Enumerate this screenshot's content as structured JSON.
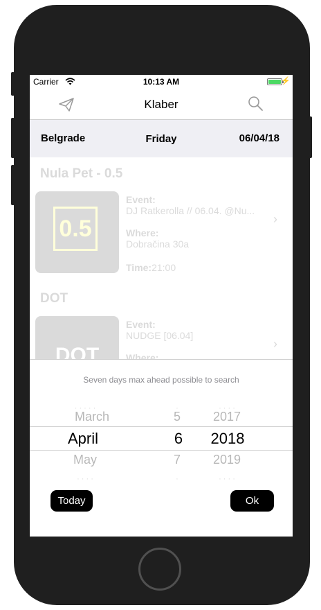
{
  "status_bar": {
    "carrier": "Carrier",
    "time": "10:13 AM",
    "battery_level": 1.0
  },
  "nav": {
    "title": "Klaber",
    "left_icon": "paper-plane-icon",
    "right_icon": "search-icon"
  },
  "info_bar": {
    "city": "Belgrade",
    "day": "Friday",
    "date": "06/04/18"
  },
  "events": [
    {
      "venue": "Nula Pet - 0.5",
      "thumb_text": "0.5",
      "event_label": "Event:",
      "event_value": "DJ Ratkerolla // 06.04. @Nu...",
      "where_label": "Where:",
      "where_value": "Dobračina 30a",
      "time_label": "Time:",
      "time_value": "21:00"
    },
    {
      "venue": "DOT",
      "thumb_text": "DOT",
      "event_label": "Event:",
      "event_value": "NUDGE [06.04]",
      "where_label": "Where:"
    }
  ],
  "date_picker": {
    "hint": "Seven days max ahead possible to search",
    "months": {
      "prev": "March",
      "selected": "April",
      "next": "May"
    },
    "days": {
      "prev": "5",
      "selected": "6",
      "next": "7"
    },
    "years": {
      "prev": "2017",
      "selected": "2018",
      "next": "2019"
    },
    "today_label": "Today",
    "ok_label": "Ok"
  },
  "colors": {
    "battery": "#4cd964",
    "accent": "#000000",
    "thumb_text": "#ffff00"
  }
}
